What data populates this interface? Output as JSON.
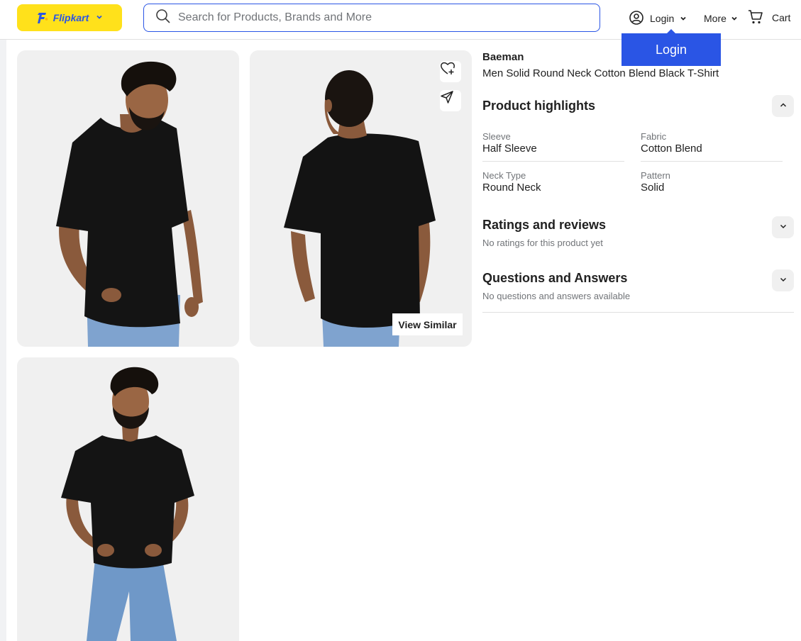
{
  "header": {
    "logo_text": "Flipkart",
    "search_placeholder": "Search for Products, Brands and More",
    "login_label": "Login",
    "more_label": "More",
    "cart_label": "Cart",
    "login_popup_label": "Login"
  },
  "gallery": {
    "view_similar_label": "View Similar"
  },
  "product": {
    "brand": "Baeman",
    "title": "Men Solid Round Neck Cotton Blend Black T-Shirt"
  },
  "highlights": {
    "title": "Product highlights",
    "items": [
      {
        "label": "Sleeve",
        "value": "Half Sleeve"
      },
      {
        "label": "Fabric",
        "value": "Cotton Blend"
      },
      {
        "label": "Neck Type",
        "value": "Round Neck"
      },
      {
        "label": "Pattern",
        "value": "Solid"
      }
    ]
  },
  "ratings": {
    "title": "Ratings and reviews",
    "subtitle": "No ratings for this product yet"
  },
  "qa": {
    "title": "Questions and Answers",
    "subtitle": "No questions and answers available"
  },
  "colors": {
    "accent": "#2a55e5",
    "logo_bg": "#ffe11b",
    "tile_bg": "#f0f0f0"
  }
}
